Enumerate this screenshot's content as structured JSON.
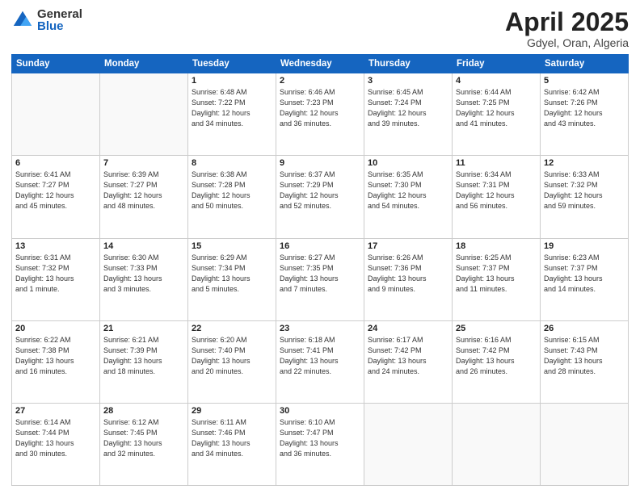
{
  "logo": {
    "general": "General",
    "blue": "Blue"
  },
  "title": {
    "month": "April 2025",
    "location": "Gdyel, Oran, Algeria"
  },
  "weekdays": [
    "Sunday",
    "Monday",
    "Tuesday",
    "Wednesday",
    "Thursday",
    "Friday",
    "Saturday"
  ],
  "weeks": [
    [
      {
        "day": "",
        "info": ""
      },
      {
        "day": "",
        "info": ""
      },
      {
        "day": "1",
        "info": "Sunrise: 6:48 AM\nSunset: 7:22 PM\nDaylight: 12 hours\nand 34 minutes."
      },
      {
        "day": "2",
        "info": "Sunrise: 6:46 AM\nSunset: 7:23 PM\nDaylight: 12 hours\nand 36 minutes."
      },
      {
        "day": "3",
        "info": "Sunrise: 6:45 AM\nSunset: 7:24 PM\nDaylight: 12 hours\nand 39 minutes."
      },
      {
        "day": "4",
        "info": "Sunrise: 6:44 AM\nSunset: 7:25 PM\nDaylight: 12 hours\nand 41 minutes."
      },
      {
        "day": "5",
        "info": "Sunrise: 6:42 AM\nSunset: 7:26 PM\nDaylight: 12 hours\nand 43 minutes."
      }
    ],
    [
      {
        "day": "6",
        "info": "Sunrise: 6:41 AM\nSunset: 7:27 PM\nDaylight: 12 hours\nand 45 minutes."
      },
      {
        "day": "7",
        "info": "Sunrise: 6:39 AM\nSunset: 7:27 PM\nDaylight: 12 hours\nand 48 minutes."
      },
      {
        "day": "8",
        "info": "Sunrise: 6:38 AM\nSunset: 7:28 PM\nDaylight: 12 hours\nand 50 minutes."
      },
      {
        "day": "9",
        "info": "Sunrise: 6:37 AM\nSunset: 7:29 PM\nDaylight: 12 hours\nand 52 minutes."
      },
      {
        "day": "10",
        "info": "Sunrise: 6:35 AM\nSunset: 7:30 PM\nDaylight: 12 hours\nand 54 minutes."
      },
      {
        "day": "11",
        "info": "Sunrise: 6:34 AM\nSunset: 7:31 PM\nDaylight: 12 hours\nand 56 minutes."
      },
      {
        "day": "12",
        "info": "Sunrise: 6:33 AM\nSunset: 7:32 PM\nDaylight: 12 hours\nand 59 minutes."
      }
    ],
    [
      {
        "day": "13",
        "info": "Sunrise: 6:31 AM\nSunset: 7:32 PM\nDaylight: 13 hours\nand 1 minute."
      },
      {
        "day": "14",
        "info": "Sunrise: 6:30 AM\nSunset: 7:33 PM\nDaylight: 13 hours\nand 3 minutes."
      },
      {
        "day": "15",
        "info": "Sunrise: 6:29 AM\nSunset: 7:34 PM\nDaylight: 13 hours\nand 5 minutes."
      },
      {
        "day": "16",
        "info": "Sunrise: 6:27 AM\nSunset: 7:35 PM\nDaylight: 13 hours\nand 7 minutes."
      },
      {
        "day": "17",
        "info": "Sunrise: 6:26 AM\nSunset: 7:36 PM\nDaylight: 13 hours\nand 9 minutes."
      },
      {
        "day": "18",
        "info": "Sunrise: 6:25 AM\nSunset: 7:37 PM\nDaylight: 13 hours\nand 11 minutes."
      },
      {
        "day": "19",
        "info": "Sunrise: 6:23 AM\nSunset: 7:37 PM\nDaylight: 13 hours\nand 14 minutes."
      }
    ],
    [
      {
        "day": "20",
        "info": "Sunrise: 6:22 AM\nSunset: 7:38 PM\nDaylight: 13 hours\nand 16 minutes."
      },
      {
        "day": "21",
        "info": "Sunrise: 6:21 AM\nSunset: 7:39 PM\nDaylight: 13 hours\nand 18 minutes."
      },
      {
        "day": "22",
        "info": "Sunrise: 6:20 AM\nSunset: 7:40 PM\nDaylight: 13 hours\nand 20 minutes."
      },
      {
        "day": "23",
        "info": "Sunrise: 6:18 AM\nSunset: 7:41 PM\nDaylight: 13 hours\nand 22 minutes."
      },
      {
        "day": "24",
        "info": "Sunrise: 6:17 AM\nSunset: 7:42 PM\nDaylight: 13 hours\nand 24 minutes."
      },
      {
        "day": "25",
        "info": "Sunrise: 6:16 AM\nSunset: 7:42 PM\nDaylight: 13 hours\nand 26 minutes."
      },
      {
        "day": "26",
        "info": "Sunrise: 6:15 AM\nSunset: 7:43 PM\nDaylight: 13 hours\nand 28 minutes."
      }
    ],
    [
      {
        "day": "27",
        "info": "Sunrise: 6:14 AM\nSunset: 7:44 PM\nDaylight: 13 hours\nand 30 minutes."
      },
      {
        "day": "28",
        "info": "Sunrise: 6:12 AM\nSunset: 7:45 PM\nDaylight: 13 hours\nand 32 minutes."
      },
      {
        "day": "29",
        "info": "Sunrise: 6:11 AM\nSunset: 7:46 PM\nDaylight: 13 hours\nand 34 minutes."
      },
      {
        "day": "30",
        "info": "Sunrise: 6:10 AM\nSunset: 7:47 PM\nDaylight: 13 hours\nand 36 minutes."
      },
      {
        "day": "",
        "info": ""
      },
      {
        "day": "",
        "info": ""
      },
      {
        "day": "",
        "info": ""
      }
    ]
  ]
}
